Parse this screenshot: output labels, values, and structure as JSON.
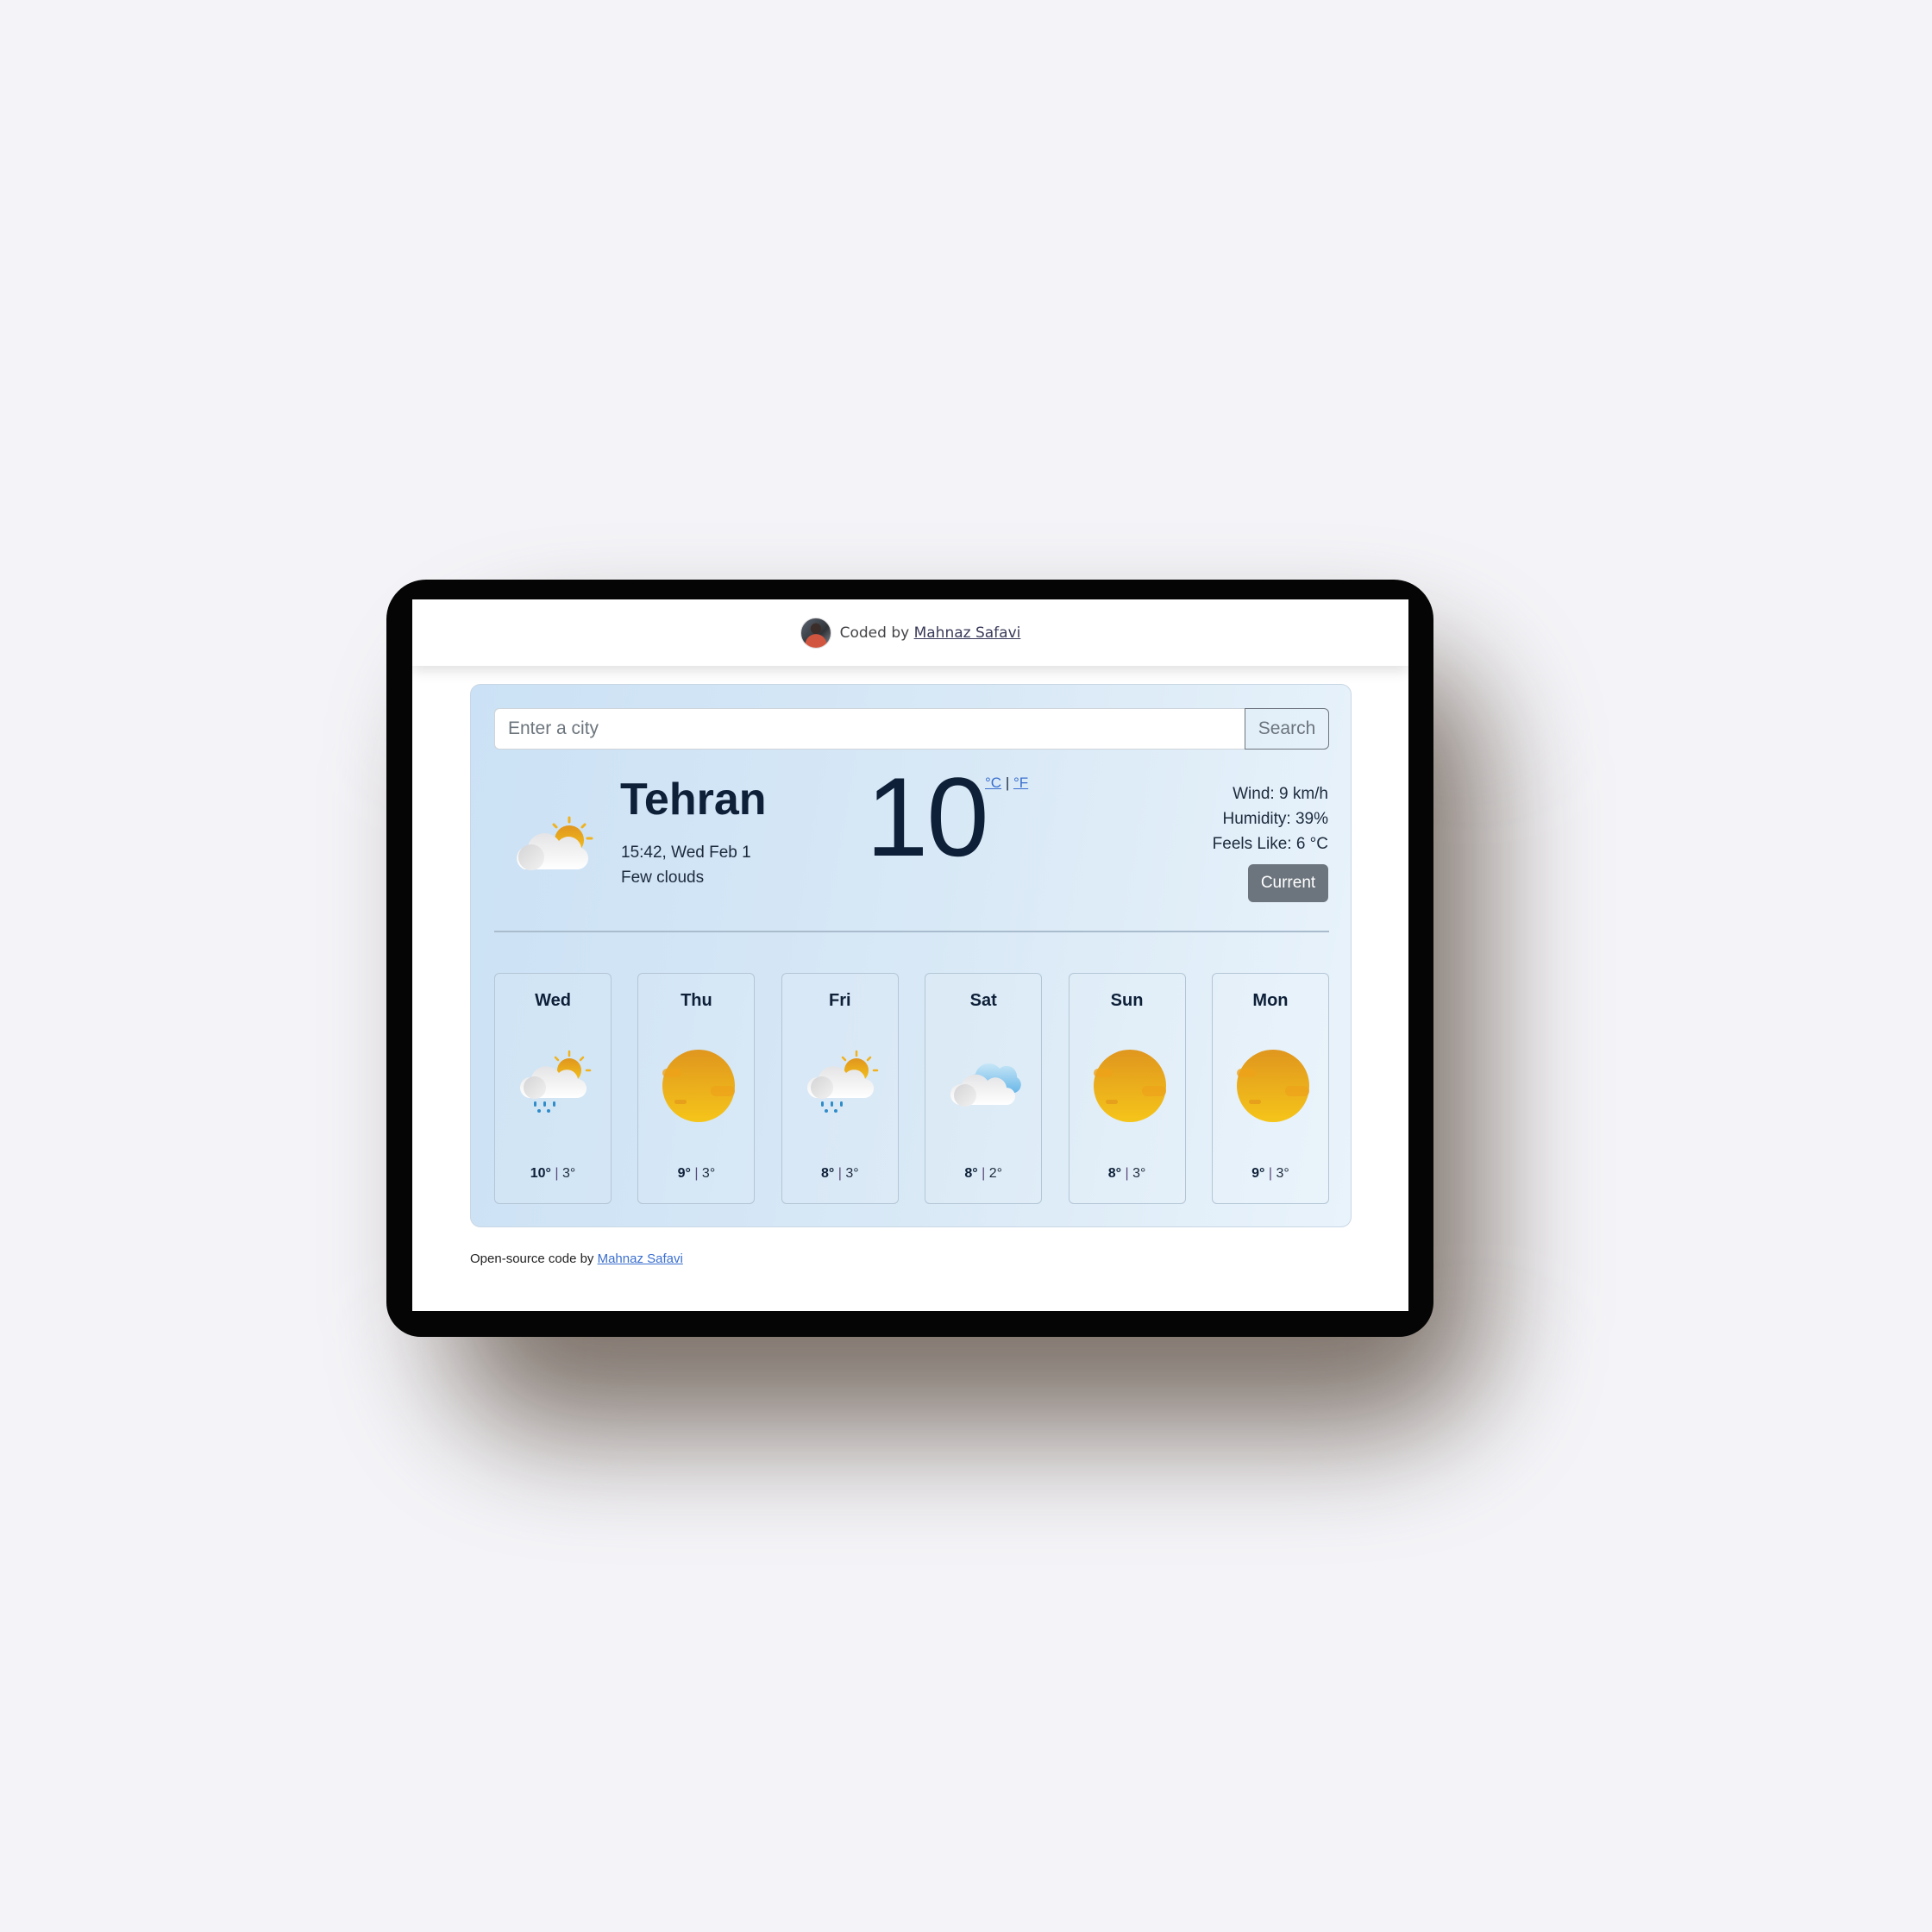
{
  "header": {
    "coded_by_prefix": "Coded by",
    "author_link": "Mahnaz Safavi"
  },
  "search": {
    "placeholder": "Enter a city",
    "value": "",
    "button_label": "Search"
  },
  "current": {
    "icon": "few-clouds-icon",
    "city": "Tehran",
    "datetime": "15:42, Wed Feb 1",
    "description": "Few clouds",
    "temperature": "10",
    "unit_celsius": "°C",
    "unit_separator": "|",
    "unit_fahrenheit": "°F",
    "wind": "Wind: 9 km/h",
    "humidity": "Humidity: 39%",
    "feels_like": "Feels Like: 6 °C",
    "current_button_label": "Current"
  },
  "forecast": [
    {
      "day": "Wed",
      "icon": "rain-sun-cloud-icon",
      "max": "10°",
      "min": "3°"
    },
    {
      "day": "Thu",
      "icon": "sun-icon",
      "max": "9°",
      "min": "3°"
    },
    {
      "day": "Fri",
      "icon": "rain-sun-cloud-icon",
      "max": "8°",
      "min": "3°"
    },
    {
      "day": "Sat",
      "icon": "clouds-icon",
      "max": "8°",
      "min": "2°"
    },
    {
      "day": "Sun",
      "icon": "sun-icon",
      "max": "8°",
      "min": "3°"
    },
    {
      "day": "Mon",
      "icon": "sun-icon",
      "max": "9°",
      "min": "3°"
    }
  ],
  "forecast_separator": "|",
  "footer": {
    "prefix": "Open-source code by",
    "author_link": "Mahnaz Safavi"
  },
  "colors": {
    "link": "#3a6fcf",
    "text_dark": "#0e2038",
    "button_secondary": "#6c757d",
    "card_gradient_start": "#cbe1f5",
    "card_gradient_end": "#e9f3fb",
    "sun": "#f0b21e",
    "device_frame": "#050505",
    "page_background": "#f4f4f8"
  }
}
